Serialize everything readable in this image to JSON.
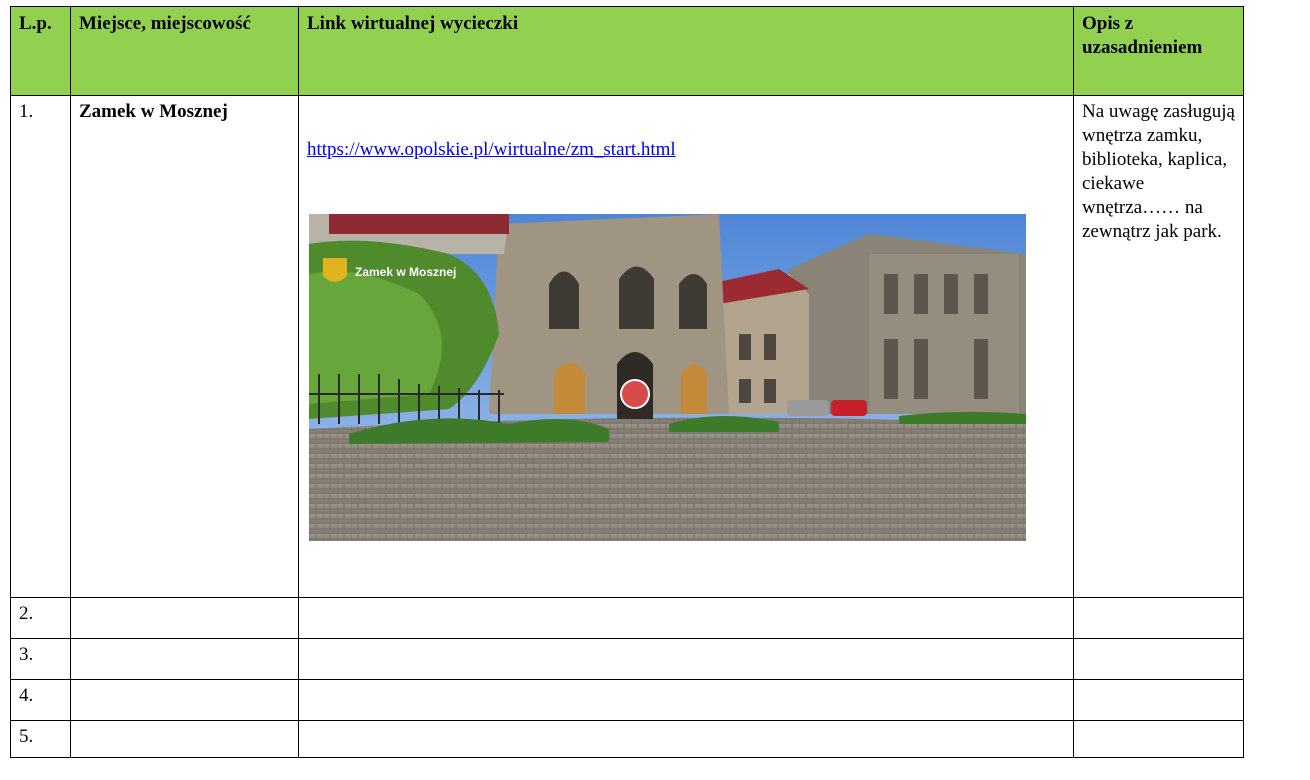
{
  "table": {
    "headers": [
      "L.p.",
      "Miejsce, miejscowość",
      "Link wirtualnej wycieczki",
      "Opis z uzasadnieniem"
    ],
    "rows": [
      {
        "num": "1.",
        "place": "Zamek w Mosznej",
        "link": "https://www.opolskie.pl/wirtualne/zm_start.html",
        "desc": "Na uwagę zasługują wnętrza zamku, biblioteka, kaplica, ciekawe wnętrza…… na zewnątrz jak park.",
        "photo_caption": "Zamek w Mosznej"
      },
      {
        "num": "2.",
        "place": "",
        "link": "",
        "desc": ""
      },
      {
        "num": "3.",
        "place": "",
        "link": "",
        "desc": ""
      },
      {
        "num": "4.",
        "place": "",
        "link": "",
        "desc": ""
      },
      {
        "num": "5.",
        "place": "",
        "link": "",
        "desc": ""
      }
    ]
  },
  "colors": {
    "header_bg": "#92d050",
    "link": "#0000ee",
    "border": "#000000"
  }
}
